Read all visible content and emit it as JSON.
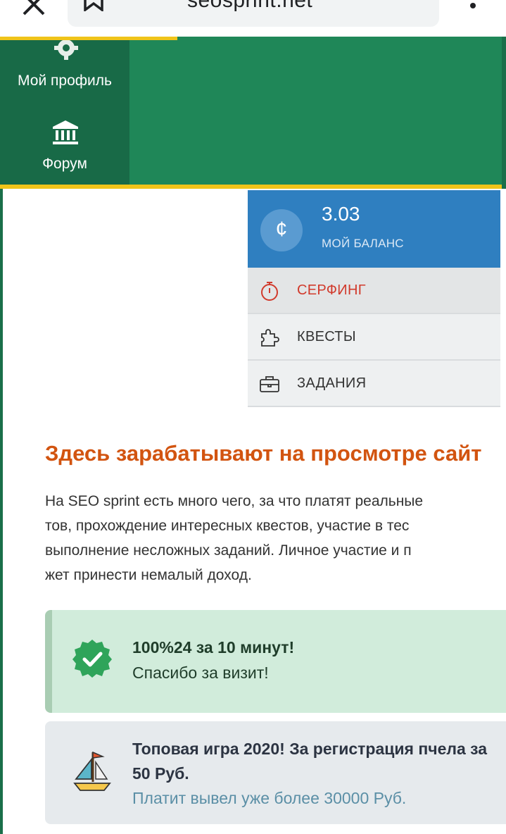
{
  "browser": {
    "url": "seosprint.net",
    "icons": [
      "close-icon",
      "bookmark-icon",
      "more-vert-icon"
    ]
  },
  "nav": {
    "profile": {
      "label": "Мой профиль",
      "icon": "gear-icon"
    },
    "forum": {
      "label": "Форум",
      "icon": "bank-icon"
    }
  },
  "balance": {
    "icon": "¢",
    "amount": "3.03",
    "caption": "МОЙ БАЛАНС"
  },
  "menu": [
    {
      "label": "СЕРФИНГ",
      "icon": "stopwatch-icon",
      "active": true
    },
    {
      "label": "КВЕСТЫ",
      "icon": "puzzle-icon",
      "active": false
    },
    {
      "label": "ЗАДАНИЯ",
      "icon": "briefcase-icon",
      "active": false
    }
  ],
  "content": {
    "heading": "Здесь зарабатывают на просмотре сайт",
    "paragraph": [
      "На SEO sprint есть много чего, за что платят реальные",
      "тов, прохождение интересных квестов, участие в тес",
      "выполнение несложных заданий. Личное участие и п",
      "жет принести немалый доход."
    ]
  },
  "notice": {
    "title": "100%24 за 10 минут!",
    "subtitle": "Спасибо за визит!"
  },
  "promo": {
    "title_line1": "Топовая игра 2020! За регистрация пчела за",
    "title_line2": "50 Руб.",
    "subtitle": "Платит вывел уже более 30000 Руб."
  },
  "colors": {
    "header_green": "#1f8758",
    "sidebar_green": "#186a47",
    "gold": "#f0c419",
    "balance_blue": "#2f7fc0",
    "heading_orange": "#d25410",
    "active_red": "#d13a2c",
    "notice_green": "#d1ecdb"
  }
}
